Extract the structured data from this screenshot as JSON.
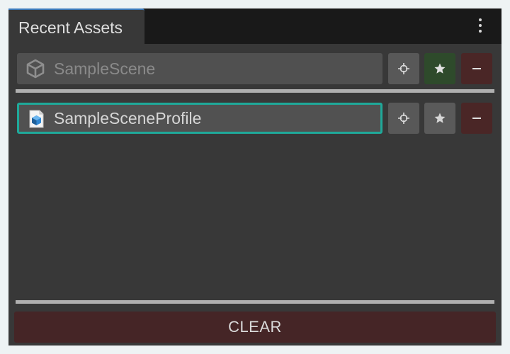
{
  "panel": {
    "tab_title": "Recent Assets",
    "menu_icon": "kebab-menu-icon"
  },
  "assets": [
    {
      "name": "SampleScene",
      "icon": "unity-scene-icon",
      "favorited": true,
      "selected": false
    },
    {
      "name": "SampleSceneProfile",
      "icon": "scriptable-object-icon",
      "favorited": false,
      "selected": true
    }
  ],
  "buttons": {
    "ping_icon": "crosshair-icon",
    "favorite_icon": "star-icon",
    "remove_icon": "minus-icon",
    "clear_label": "CLEAR"
  },
  "colors": {
    "selection_outline": "#1fa99a",
    "favorite_active": "#2e4a2b",
    "remove": "#4a2626",
    "clear": "#452526",
    "tab_accent": "#3a79bb"
  }
}
